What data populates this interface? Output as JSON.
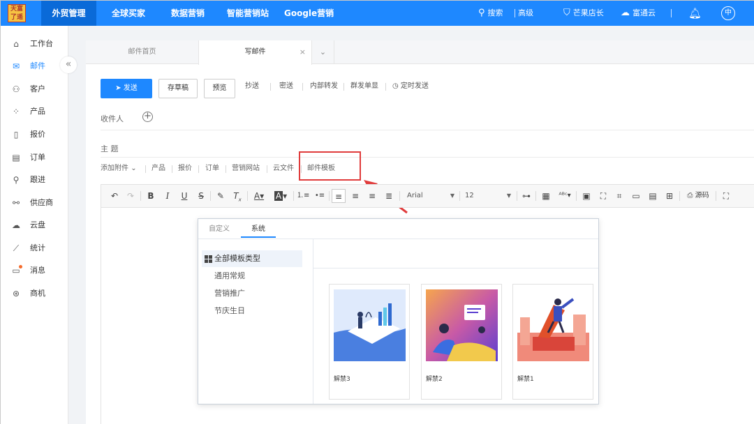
{
  "topbar": {
    "logo_text": "天富\n了 遥",
    "nav": [
      "外贸管理",
      "全球买家",
      "数据营销",
      "智能营销站",
      "Google营销"
    ],
    "search_label": "搜索",
    "advanced_label": "高级",
    "shop_label": "芒果店长",
    "cloud_label": "富通云",
    "lang_label": "中"
  },
  "sidebar": {
    "items": [
      "工作台",
      "邮件",
      "客户",
      "产品",
      "报价",
      "订单",
      "跟进",
      "供应商",
      "云盘",
      "统计",
      "消息",
      "商机"
    ],
    "collapse_icon": "«"
  },
  "tabs": {
    "home": "邮件首页",
    "compose": "写邮件",
    "close": "×",
    "more": "⌄"
  },
  "actions": {
    "send": "发送",
    "draft": "存草稿",
    "preview": "预览",
    "cc": "抄送",
    "bcc": "密送",
    "forward_internal": "内部转发",
    "group_single": "群发单显",
    "schedule": "定时发送"
  },
  "fields": {
    "recipient_label": "收件人",
    "subject_label": "主 题"
  },
  "attach_bar": [
    "添加附件",
    "产品",
    "报价",
    "订单",
    "营销网站",
    "云文件",
    "邮件模板"
  ],
  "toolbar": {
    "font": "Arial",
    "size": "12",
    "source_label": "源码"
  },
  "template_popup": {
    "tabs": [
      "自定义",
      "系统"
    ],
    "categories": [
      "全部模板类型",
      "通用常规",
      "营销推广",
      "节庆生日"
    ],
    "cards": [
      "解禁3",
      "解禁2",
      "解禁1"
    ]
  },
  "colors": {
    "brand": "#1e88ff",
    "highlight": "#e03b3b"
  }
}
